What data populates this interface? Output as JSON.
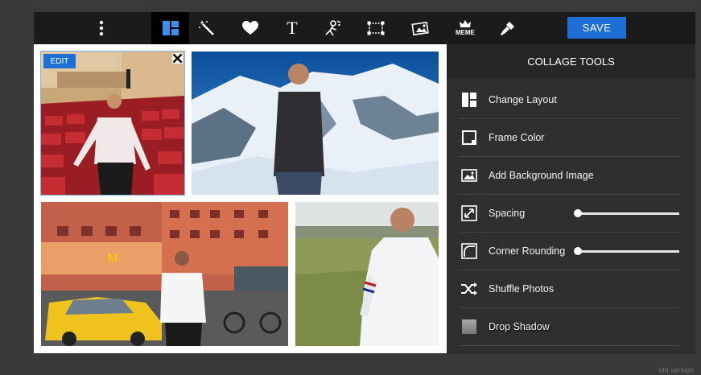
{
  "toolbar": {
    "tools": [
      {
        "name": "menu-icon"
      },
      {
        "name": "layout-icon",
        "active": true
      },
      {
        "name": "magic-wand-icon"
      },
      {
        "name": "heart-icon"
      },
      {
        "name": "text-icon",
        "glyph": "T"
      },
      {
        "name": "clip-art-icon"
      },
      {
        "name": "frame-icon"
      },
      {
        "name": "image-overlay-icon"
      },
      {
        "name": "meme-icon",
        "caption": "MEME"
      },
      {
        "name": "paint-brush-icon"
      }
    ],
    "save_label": "SAVE"
  },
  "canvas": {
    "edit_label": "EDIT",
    "photos": [
      {
        "name": "photo-auditorium"
      },
      {
        "name": "photo-snowy-mountains"
      },
      {
        "name": "photo-city-street"
      },
      {
        "name": "photo-field"
      }
    ]
  },
  "panel": {
    "title": "COLLAGE TOOLS",
    "tools": [
      {
        "label": "Change Layout",
        "icon": "layout-icon"
      },
      {
        "label": "Frame Color",
        "icon": "frame-color-icon"
      },
      {
        "label": "Add Background Image",
        "icon": "image-icon"
      },
      {
        "label": "Spacing",
        "icon": "resize-arrows-icon",
        "slider": 0.0
      },
      {
        "label": "Corner Rounding",
        "icon": "corner-rounding-icon",
        "slider": 0.0
      },
      {
        "label": "Shuffle Photos",
        "icon": "shuffle-icon"
      },
      {
        "label": "Drop Shadow",
        "icon": "drop-shadow-icon"
      }
    ]
  },
  "footer": {
    "old_version": "old version"
  },
  "colors": {
    "accent": "#1d6fd6",
    "toolbar_bg": "#1b1b1b",
    "panel_bg": "#2f2f2f",
    "page_bg": "#3a3a3a"
  }
}
